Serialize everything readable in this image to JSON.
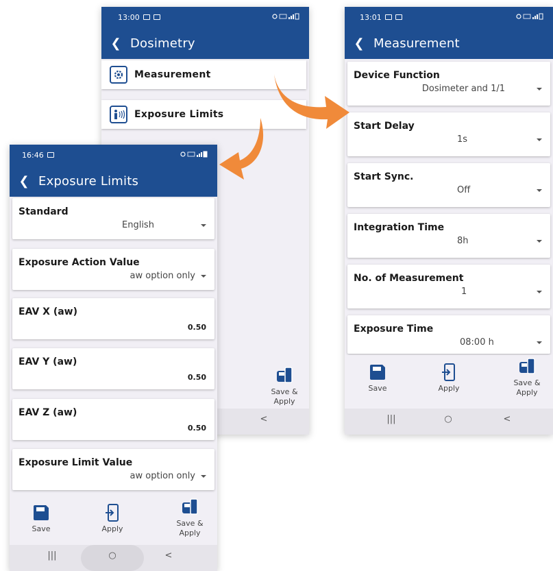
{
  "colors": {
    "primary": "#1e4e91",
    "accent": "#f08a3a",
    "background": "#f1eff5"
  },
  "dosimetry": {
    "status_time": "13:00",
    "title": "Dosimetry",
    "menu": [
      {
        "label": "Measurement",
        "icon": "gear-icon"
      },
      {
        "label": "Exposure Limits",
        "icon": "vibration-icon"
      }
    ],
    "save_apply_label_1": "Save &",
    "save_apply_label_2": "Apply"
  },
  "measurement": {
    "status_time": "13:01",
    "title": "Measurement",
    "settings": [
      {
        "label": "Device Function",
        "value": "Dosimeter and 1/1"
      },
      {
        "label": "Start Delay",
        "value": "1s"
      },
      {
        "label": "Start Sync.",
        "value": "Off"
      },
      {
        "label": "Integration Time",
        "value": "8h"
      },
      {
        "label": "No. of Measurement",
        "value": "1"
      },
      {
        "label": "Exposure Time",
        "value": "08:00 h"
      }
    ],
    "actions": {
      "save": "Save",
      "apply": "Apply",
      "save_apply_1": "Save &",
      "save_apply_2": "Apply"
    }
  },
  "exposure_limits": {
    "status_time": "16:46",
    "title": "Exposure Limits",
    "settings": [
      {
        "label": "Standard",
        "value": "English",
        "kind": "dropdown"
      },
      {
        "label": "Exposure Action Value",
        "value": "aw option only",
        "kind": "dropdown"
      },
      {
        "label": "EAV X (aw)",
        "value": "0.50",
        "kind": "number"
      },
      {
        "label": "EAV Y (aw)",
        "value": "0.50",
        "kind": "number"
      },
      {
        "label": "EAV Z (aw)",
        "value": "0.50",
        "kind": "number"
      },
      {
        "label": "Exposure Limit Value",
        "value": "aw option only",
        "kind": "dropdown"
      }
    ],
    "actions": {
      "save": "Save",
      "apply": "Apply",
      "save_apply_1": "Save &",
      "save_apply_2": "Apply"
    }
  },
  "nav": {
    "recents": "|||",
    "home": "○",
    "back": "<"
  }
}
